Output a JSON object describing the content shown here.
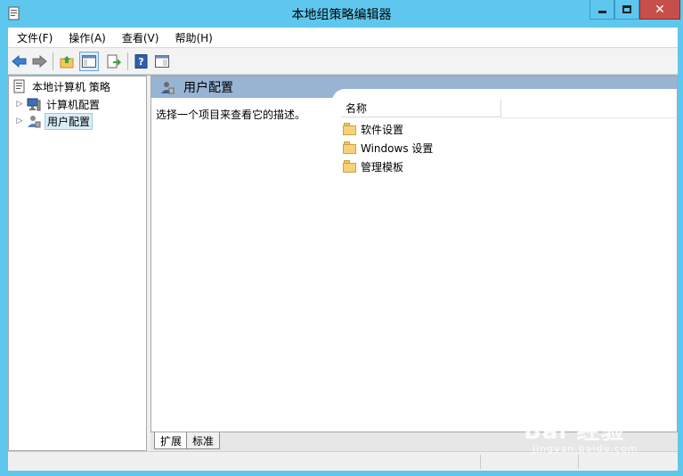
{
  "window": {
    "title": "本地组策略编辑器",
    "close_glyph": "✕"
  },
  "menu": [
    {
      "label": "文件(F)"
    },
    {
      "label": "操作(A)"
    },
    {
      "label": "查看(V)"
    },
    {
      "label": "帮助(H)"
    }
  ],
  "toolbar": {
    "icons": [
      "back-arrow-icon",
      "forward-arrow-icon",
      "up-folder-icon",
      "show-hide-tree-icon",
      "export-list-icon",
      "help-icon",
      "properties-icon"
    ]
  },
  "tree": {
    "root": "本地计算机 策略",
    "items": [
      {
        "label": "计算机配置",
        "expander": "▷"
      },
      {
        "label": "用户配置",
        "expander": "▷"
      }
    ]
  },
  "detail": {
    "header": "用户配置",
    "description": "选择一个项目来查看它的描述。",
    "column_name": "名称",
    "items": [
      {
        "label": "软件设置"
      },
      {
        "label": "Windows 设置"
      },
      {
        "label": "管理模板"
      }
    ]
  },
  "tabs": [
    {
      "label": "扩展"
    },
    {
      "label": "标准"
    }
  ],
  "watermark": {
    "main": "Bai 经验",
    "sub": "jingyan.baidu.com"
  },
  "colors": {
    "titlebar": "#5fc7ee",
    "detail_header": "#97b4d2",
    "close_button": "#c74f4b",
    "selection": "#d9ecf8"
  }
}
